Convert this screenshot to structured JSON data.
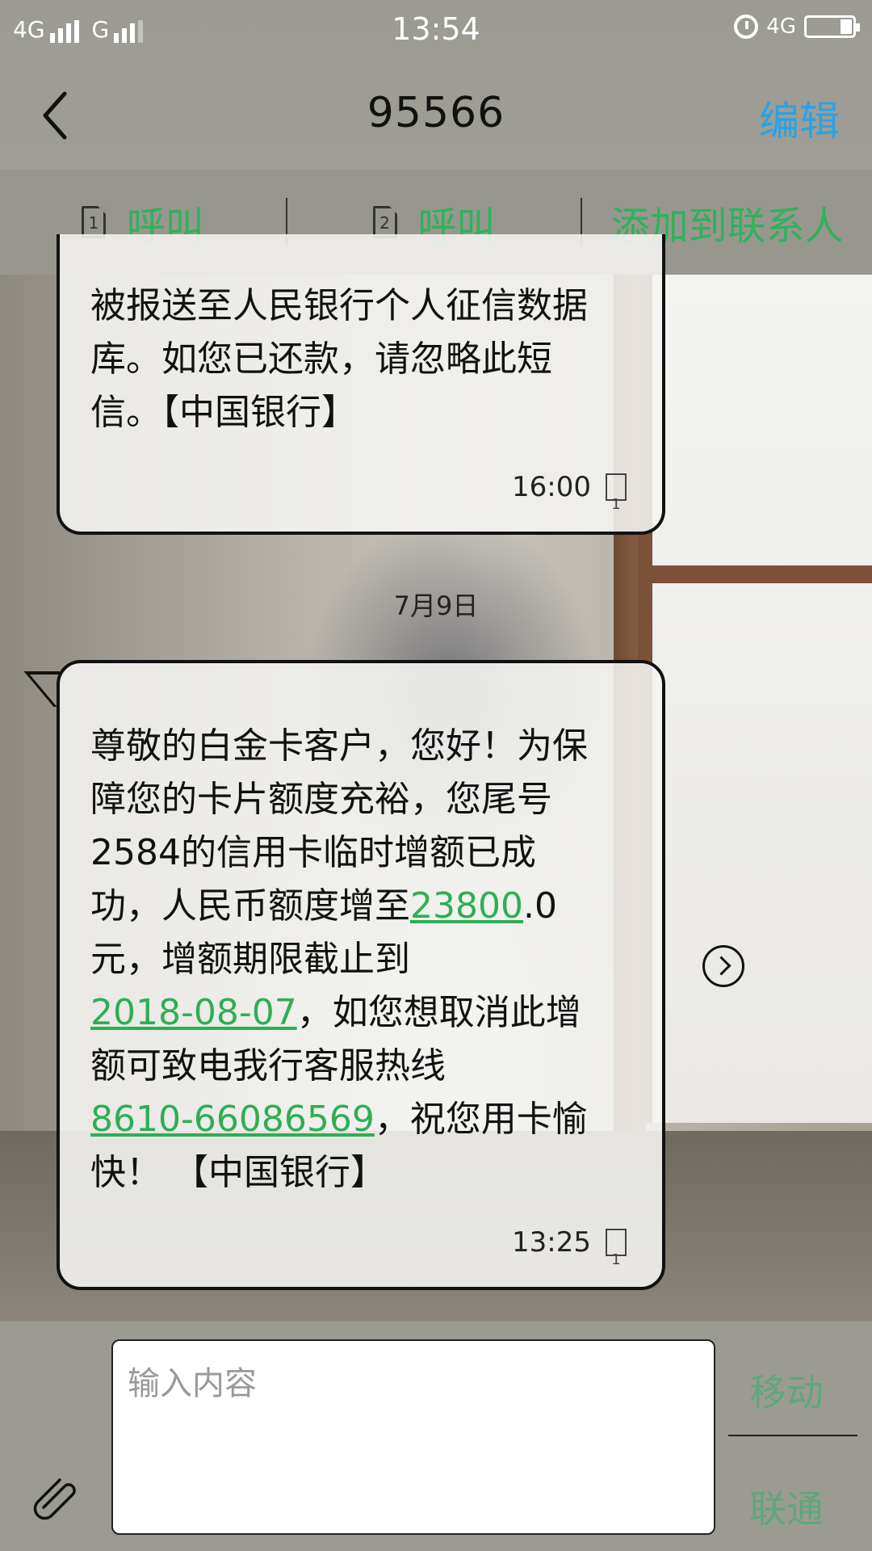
{
  "status_bar": {
    "left_network1": "4G",
    "left_network2": "G",
    "time": "13:54",
    "right_network": "4G"
  },
  "header": {
    "title": "95566",
    "edit_label": "编辑"
  },
  "actions": {
    "call_sim1": {
      "sim": "1",
      "label": "呼叫"
    },
    "call_sim2": {
      "sim": "2",
      "label": "呼叫"
    },
    "add_contact": "添加到联系人"
  },
  "messages": {
    "first": {
      "text": "被报送至人民银行个人征信数据\n库。如您已还款，请忽略此短\n信。【中国银行】",
      "time": "16:00",
      "sim": "1"
    },
    "date_divider": "7月9日",
    "second": {
      "part1": "尊敬的白金卡客户，您好！为保\n障您的卡片额度充裕，您尾号\n2584的信用卡临时增额已成\n功，人民币额度增至",
      "link_amount": "23800",
      "part2": ".0\n元，增额期限截止到\n",
      "link_date": "2018-08-07",
      "part3": "，如您想取消此增\n额可致电我行客服热线\n",
      "link_phone": "8610-66086569",
      "part4": "，祝您用卡愉\n快！ 【中国银行】",
      "time": "13:25",
      "sim": "1"
    }
  },
  "composer": {
    "placeholder": "输入内容",
    "carrier_top": "移动",
    "carrier_bottom": "联通"
  }
}
